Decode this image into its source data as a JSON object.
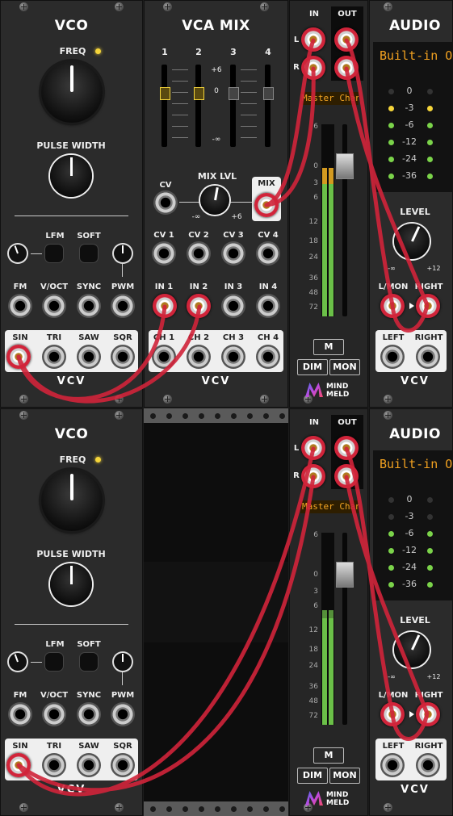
{
  "rows": [
    {
      "vco": {
        "title": "VCO",
        "freq_label": "FREQ",
        "pulse_label": "PULSE WIDTH",
        "lfm_label": "LFM",
        "soft_label": "SOFT",
        "inputs": [
          "FM",
          "V/OCT",
          "SYNC",
          "PWM"
        ],
        "outputs": [
          "SIN",
          "TRI",
          "SAW",
          "SQR"
        ],
        "brand": "VCV"
      },
      "vca": {
        "title": "VCA MIX",
        "channel_numbers": [
          "1",
          "2",
          "3",
          "4"
        ],
        "scale": [
          "+6",
          "0",
          "-∞"
        ],
        "mix_label": "MIX LVL",
        "cv_label": "CV",
        "mix_out_label": "MIX",
        "mix_min": "-∞",
        "mix_max": "+6",
        "cv_inputs": [
          "CV 1",
          "CV 2",
          "CV 3",
          "CV 4"
        ],
        "inputs": [
          "IN 1",
          "IN 2",
          "IN 3",
          "IN 4"
        ],
        "outputs": [
          "CH 1",
          "CH 2",
          "CH 3",
          "CH 4"
        ],
        "brand": "VCV"
      },
      "master": {
        "in_label": "IN",
        "out_label": "OUT",
        "l_label": "L",
        "r_label": "R",
        "name": "Master Channel",
        "scale": [
          "6",
          "0",
          "3",
          "6",
          "12",
          "18",
          "24",
          "36",
          "48",
          "72"
        ],
        "mute_label": "M",
        "dim_label": "DIM",
        "mon_label": "MON",
        "brand": "MIND MELD"
      },
      "audio": {
        "title": "AUDIO",
        "device": "Built-in Output",
        "levels": [
          "0",
          "-3",
          "-6",
          "-12",
          "-24",
          "-36"
        ],
        "level_label": "LEVEL",
        "level_min": "-∞",
        "level_max": "+12",
        "out_labels": [
          "L/MON",
          "RIGHT"
        ],
        "in_labels": [
          "LEFT",
          "RIGHT"
        ],
        "brand": "VCV"
      }
    },
    {
      "vco": {
        "title": "VCO",
        "freq_label": "FREQ",
        "pulse_label": "PULSE WIDTH",
        "lfm_label": "LFM",
        "soft_label": "SOFT",
        "inputs": [
          "FM",
          "V/OCT",
          "SYNC",
          "PWM"
        ],
        "outputs": [
          "SIN",
          "TRI",
          "SAW",
          "SQR"
        ],
        "brand": "VCV"
      },
      "master": {
        "in_label": "IN",
        "out_label": "OUT",
        "l_label": "L",
        "r_label": "R",
        "name": "Master Channel",
        "scale": [
          "6",
          "0",
          "3",
          "6",
          "12",
          "18",
          "24",
          "36",
          "48",
          "72"
        ],
        "mute_label": "M",
        "dim_label": "DIM",
        "mon_label": "MON",
        "brand": "MIND MELD"
      },
      "audio": {
        "title": "AUDIO",
        "device": "Built-in Output",
        "levels": [
          "0",
          "-3",
          "-6",
          "-12",
          "-24",
          "-36"
        ],
        "level_label": "LEVEL",
        "level_min": "-∞",
        "level_max": "+12",
        "out_labels": [
          "L/MON",
          "RIGHT"
        ],
        "in_labels": [
          "LEFT",
          "RIGHT"
        ],
        "brand": "VCV"
      }
    }
  ],
  "colors": {
    "cable": "#d1243a",
    "led_green": "#7bd34a",
    "led_yellow": "#f5d53a",
    "display_amber": "#f5a623"
  }
}
